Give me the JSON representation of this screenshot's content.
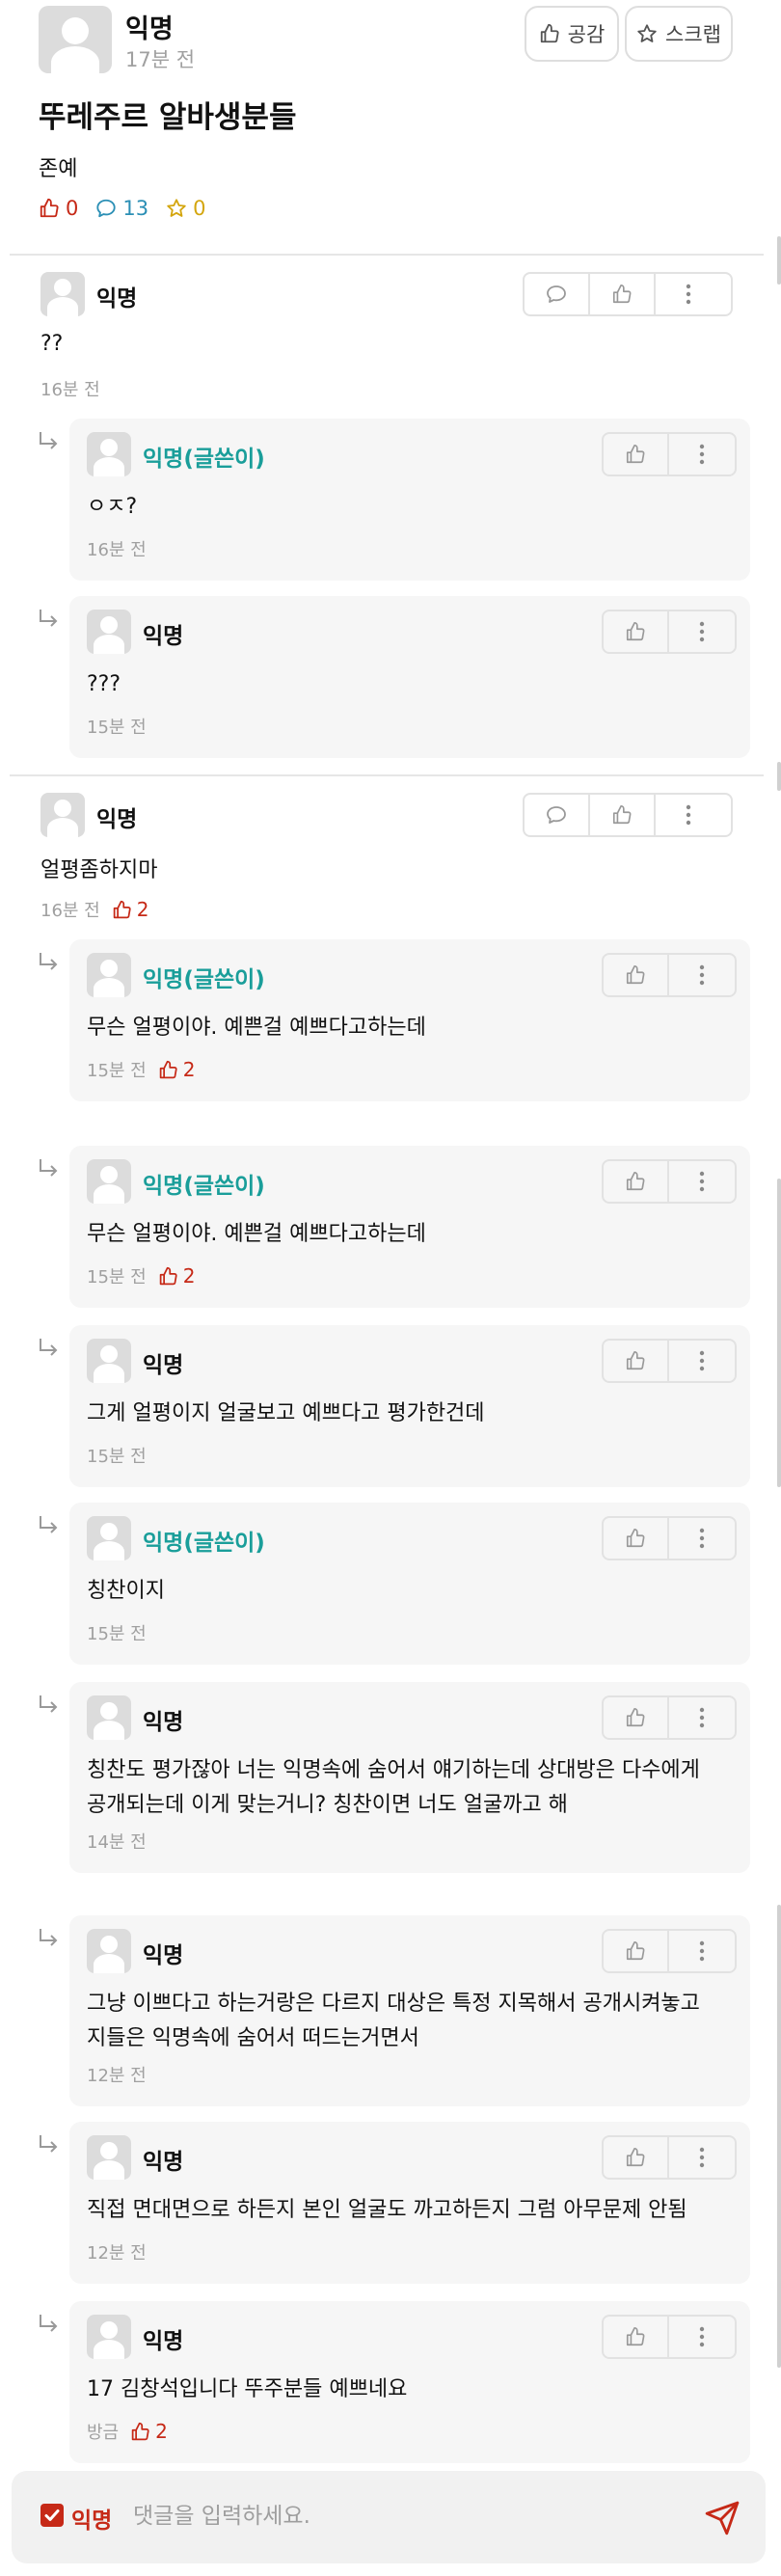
{
  "colors": {
    "accent": "#c62917",
    "author": "#1a9e9a",
    "comment": "#2b8fb5",
    "scrap": "#d4a60e"
  },
  "post": {
    "author": "익명",
    "time": "17분 전",
    "like_button": "공감",
    "scrap_button": "스크랩",
    "title": "뚜레주르 알바생분들",
    "body": "존예",
    "likes": "0",
    "comments": "13",
    "scraps": "0"
  },
  "comments": [
    {
      "name": "익명",
      "text": "??",
      "time": "16분 전",
      "likes": "",
      "replies": [
        {
          "name": "익명(글쓴이)",
          "is_author": true,
          "lines": [
            "ㅇㅈ?"
          ],
          "time": "16분 전",
          "likes": ""
        },
        {
          "name": "익명",
          "is_author": false,
          "lines": [
            "???"
          ],
          "time": "15분 전",
          "likes": ""
        }
      ]
    },
    {
      "name": "익명",
      "text": "얼평좀하지마",
      "time": "16분 전",
      "likes": "2",
      "replies": [
        {
          "name": "익명(글쓴이)",
          "is_author": true,
          "lines": [
            "무슨 얼평이야. 예쁜걸 예쁘다고하는데"
          ],
          "time": "15분 전",
          "likes": "2"
        },
        {
          "name": "익명(글쓴이)",
          "is_author": true,
          "lines": [
            "무슨 얼평이야. 예쁜걸 예쁘다고하는데"
          ],
          "time": "15분 전",
          "likes": "2"
        },
        {
          "name": "익명",
          "is_author": false,
          "lines": [
            "그게 얼평이지 얼굴보고 예쁘다고 평가한건데"
          ],
          "time": "15분 전",
          "likes": ""
        },
        {
          "name": "익명(글쓴이)",
          "is_author": true,
          "lines": [
            "칭찬이지"
          ],
          "time": "15분 전",
          "likes": ""
        },
        {
          "name": "익명",
          "is_author": false,
          "lines": [
            "칭찬도 평가잖아 너는 익명속에 숨어서 얘기하는데 상대방은 다수에게",
            "공개되는데 이게 맞는거니? 칭찬이면 너도 얼굴까고 해"
          ],
          "time": "14분 전",
          "likes": ""
        },
        {
          "name": "익명",
          "is_author": false,
          "lines": [
            "그냥 이쁘다고 하는거랑은 다르지 대상은 특정 지목해서 공개시켜놓고",
            "지들은 익명속에 숨어서 떠드는거면서"
          ],
          "time": "12분 전",
          "likes": ""
        },
        {
          "name": "익명",
          "is_author": false,
          "lines": [
            "직접 면대면으로 하든지 본인 얼굴도 까고하든지 그럼 아무문제 안됨"
          ],
          "time": "12분 전",
          "likes": ""
        },
        {
          "name": "익명",
          "is_author": false,
          "lines": [
            "17 김창석입니다 뚜주분들 예쁘네요"
          ],
          "time": "방금",
          "likes": "2"
        }
      ]
    }
  ],
  "comment_bar": {
    "anonymous_label": "익명",
    "placeholder": "댓글을 입력하세요."
  }
}
